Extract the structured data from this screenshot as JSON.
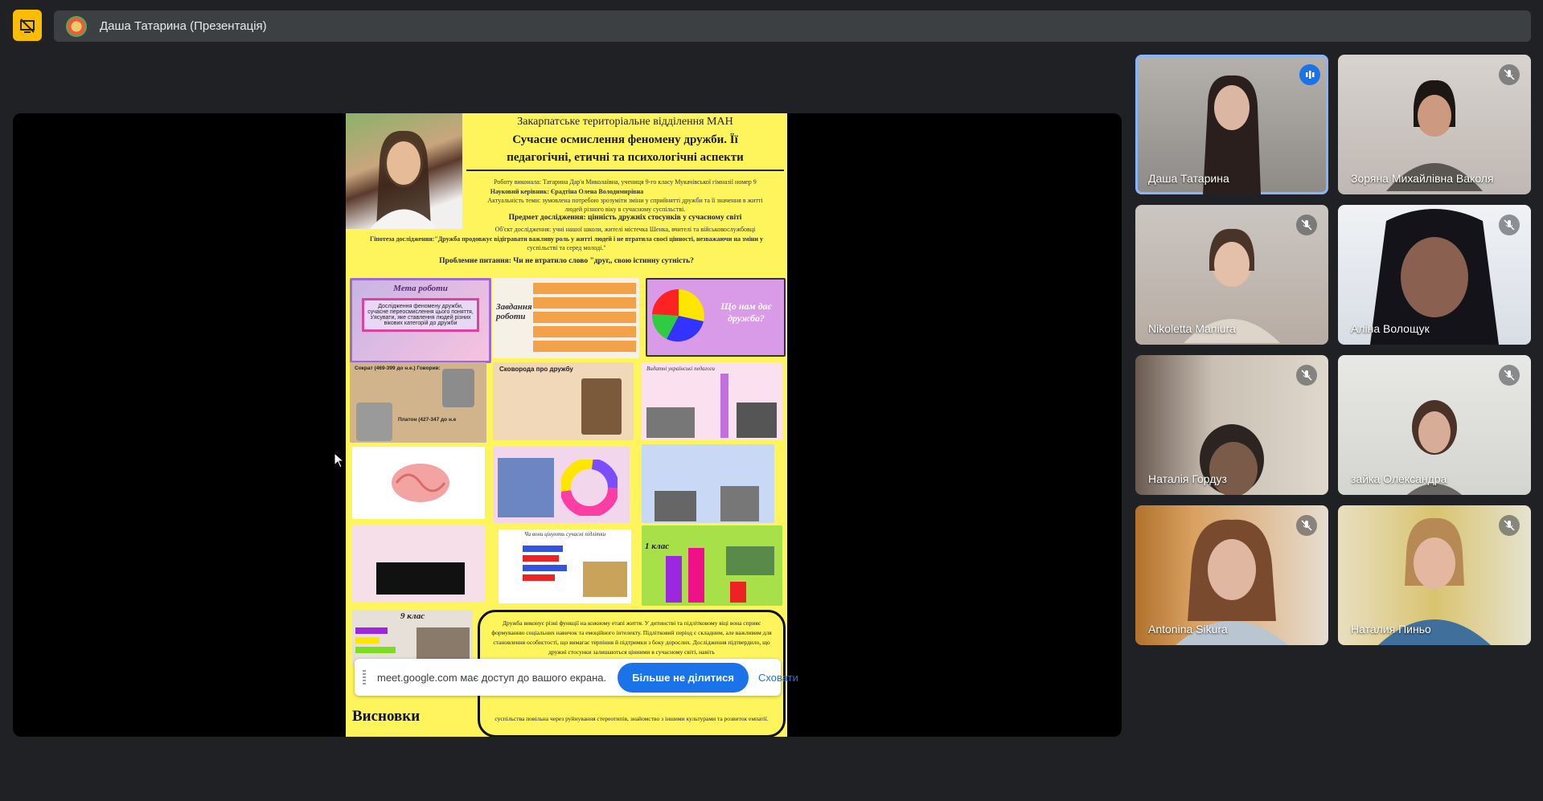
{
  "header": {
    "presenter_title": "Даша Татарина (Презентація)"
  },
  "slide": {
    "org": "Закарпатське територіальне відділення МАН",
    "title_line1": "Сучасне осмислення феномену  дружби. Її",
    "title_line2": "педагогічні, етичні та психологічні аспекти",
    "author": "Роботу виконала: Татарина Дар'я Миколаївна, учениця 9-го класу Мукачівської гімназії номер 9",
    "supervisor": "Науковий керівник: Єрадтіна Олена Володимирівна",
    "relevance_line1": "Актуальність теми: зумовлена потребою зрозуміти зміни у сприйнятті дружби та її значення в житті",
    "relevance_line2": "людей різного віку в сучасному суспільстві.",
    "subject": "Предмет дослідження: цінність дружніх стосунків у сучасному світі",
    "object": "Об'єкт дослідження: учні нашої школи, жителі містечка Шенка, вчителі та військовослужбовці",
    "hypothesis_line1": "Гіпотеза дослідження:\"Дружба продовжує відігравати важливу роль у житті людей і не втратила своєї цінності, незважаючи на зміни у",
    "hypothesis_line2": "суспільстві та серед молоді.\"",
    "problem": "Проблемне питання: Чи не втратило слово \"друг,, свою істинну сутність?",
    "card_goal_title": "Мета роботи",
    "card_goal_text": "Дослідження феномену дружби, сучасне переосмислення цього поняття, з'ясувати, яке ставлення людей різних вікових категорій до дружби",
    "card_tasks": "Завдання роботи",
    "card_why": "Що нам дає дружба?",
    "card_socrates": "Сократ (469-399 до н.е.) Говорив:",
    "card_plato": "Платон (427-347 до н.е",
    "card_skovoroda": "Сковорода про дружбу",
    "card_teachers": "Видатні українські педагоги",
    "card_survey": "Чи вони цінують сучасні підлітки",
    "card_class": "9 клас",
    "card_grade": "1 клас",
    "conclusions_text": "Дружба виконує різні функції на кожному етапі життя. У дитинстві та підлітковому віці вона сприяє формуванню соціальних навичок та емоційного інтелекту. Підлітковий період є складним, але важливим для становлення особистості, що вимагає терпіння й підтримки з боку дорослих. Дослідження підтвердило, що дружні стосунки залишаються цінними в сучасному світі, навіть",
    "conclusions_bottom": "суспільства повільна через руйнування стереотипів, знайомство з іншими культурами та розвиток емпатії.",
    "conclusions_label": "Висновки"
  },
  "share_bar": {
    "message": "meet.google.com має доступ до вашого екрана.",
    "stop_label": "Більше не ділитися",
    "hide_label": "Сховати"
  },
  "participants": [
    {
      "name": "Даша Татарина",
      "speaking": true
    },
    {
      "name": "Зоряна Михайлівна Ваколя",
      "muted": true
    },
    {
      "name": "Nikoletta Maniura",
      "muted": true
    },
    {
      "name": "Аліна Волощук",
      "muted": true
    },
    {
      "name": "Наталія Гордуз",
      "muted": true
    },
    {
      "name": "зайка Олександра",
      "muted": true
    },
    {
      "name": "Antonina Sikura",
      "muted": true
    },
    {
      "name": "Наталия Пиньо",
      "muted": true
    }
  ],
  "colors": {
    "background": "#202124",
    "accent": "#1a73e8",
    "stop_share": "#fbbc04",
    "slide_yellow": "#fef55c"
  }
}
